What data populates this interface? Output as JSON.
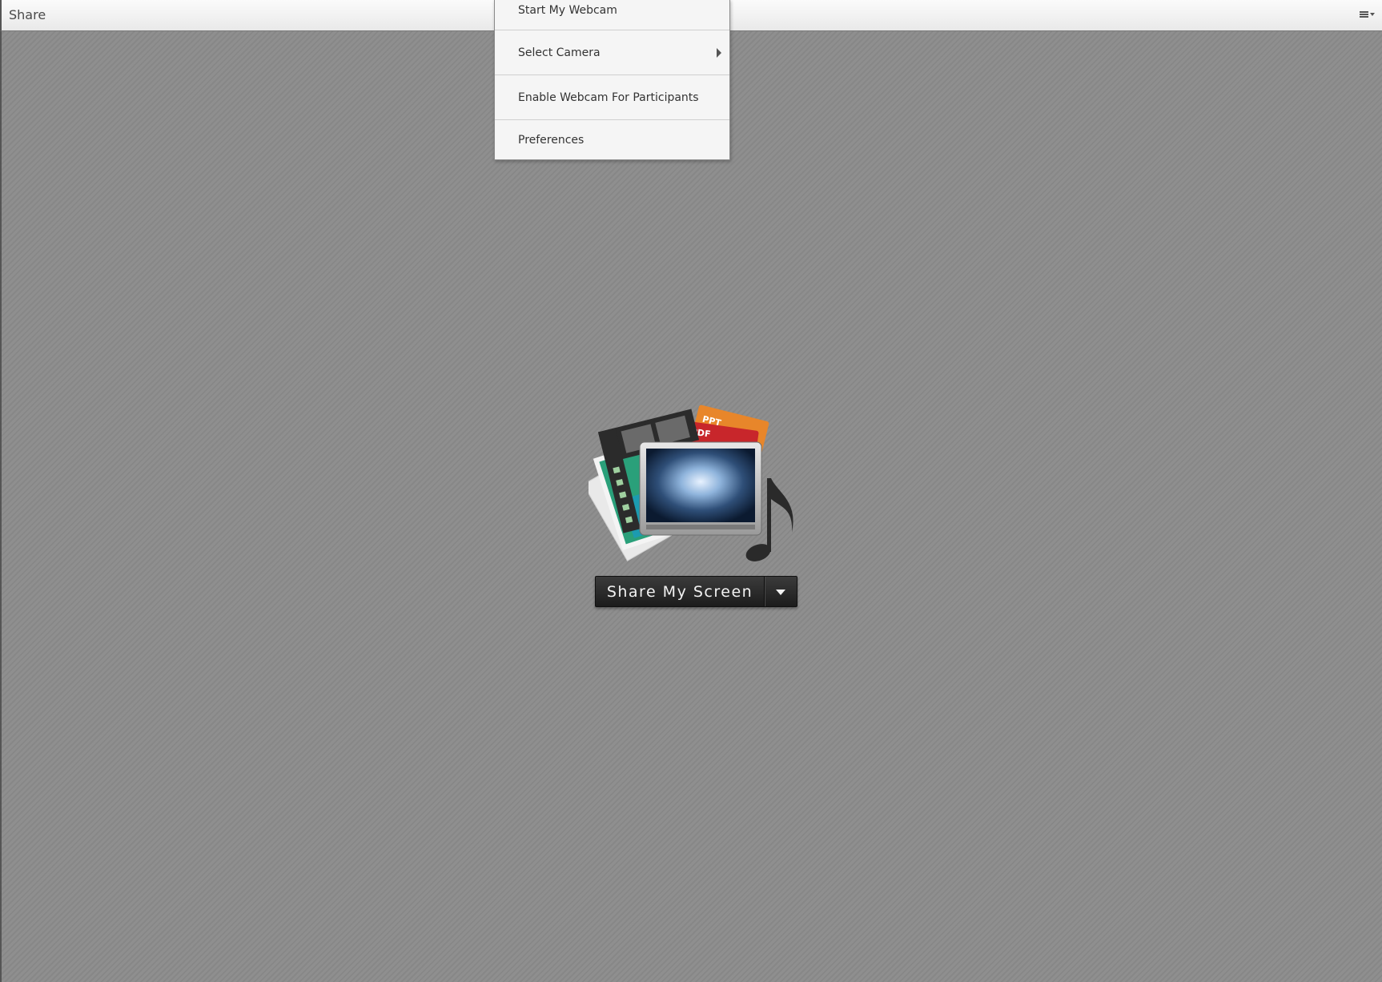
{
  "pod": {
    "title": "Share"
  },
  "menu": {
    "items": [
      {
        "label": "Start My Webcam"
      },
      {
        "label": "Select Camera",
        "has_submenu": true
      },
      {
        "label": "Enable Webcam For Participants"
      },
      {
        "label": "Preferences"
      }
    ]
  },
  "graphic": {
    "ppt_label": "PPT",
    "pdf_label": "PDF"
  },
  "share_button": {
    "label": "Share My Screen"
  },
  "icons": {
    "pod_menu": "pod-options-menu-icon",
    "submenu": "submenu-arrow-icon",
    "dropdown": "dropdown-triangle-icon"
  }
}
